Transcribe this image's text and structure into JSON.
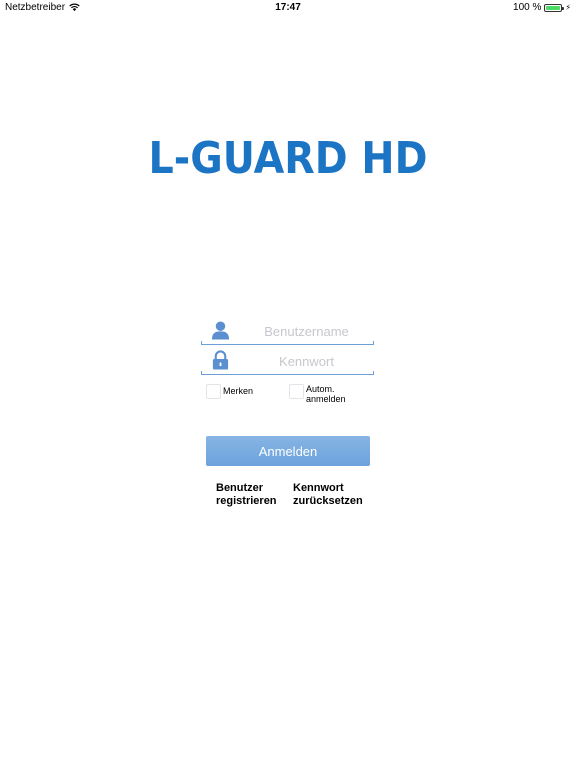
{
  "status_bar": {
    "carrier": "Netzbetreiber",
    "time": "17:47",
    "battery": "100 %",
    "battery_level": 1.0
  },
  "logo": {
    "text": "L-GUARD HD",
    "color": "#1c74c4"
  },
  "login_form": {
    "username_placeholder": "Benutzername",
    "username_value": "",
    "password_placeholder": "Kennwort",
    "password_value": "",
    "remember_label": "Merken",
    "auto_login_label_line1": "Autom.",
    "auto_login_label_line2": "anmelden",
    "remember_checked": false,
    "auto_login_checked": false,
    "submit_label": "Anmelden",
    "accent_color": "#6f9fd8",
    "icons": {
      "username": "user-icon",
      "password": "lock-icon"
    }
  },
  "links": {
    "register_line1": "Benutzer",
    "register_line2": "registrieren",
    "reset_line1": "Kennwort",
    "reset_line2": "zurücksetzen"
  }
}
